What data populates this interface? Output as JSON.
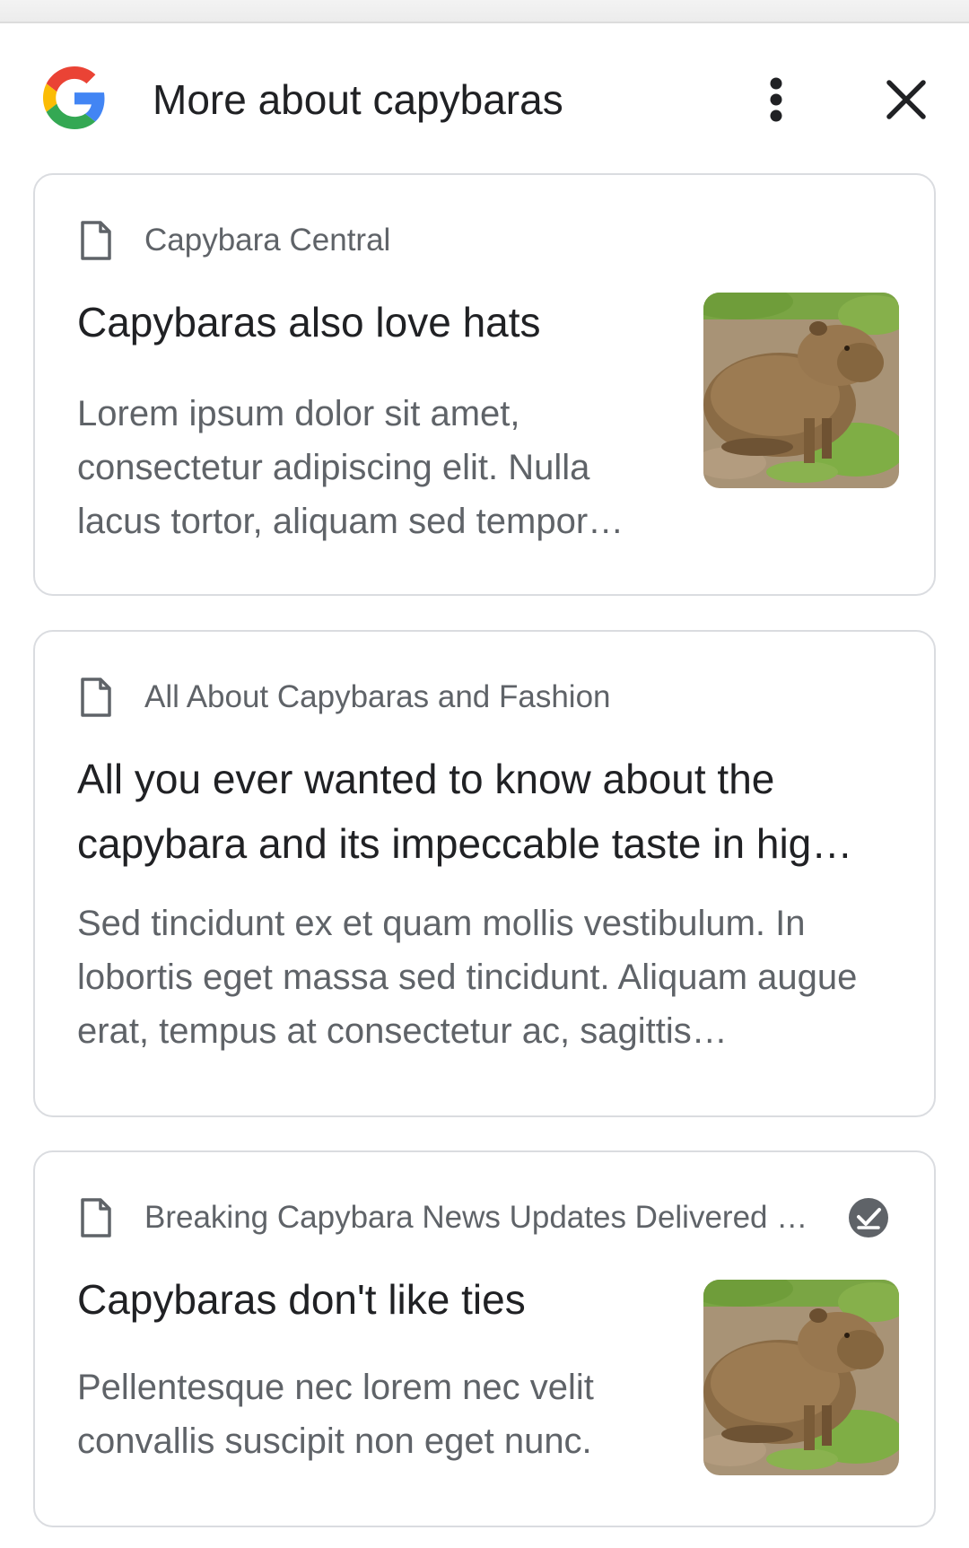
{
  "header": {
    "title": "More about capybaras",
    "logo_icon": "google-g-icon",
    "more_icon": "more-vert-icon",
    "close_icon": "close-icon"
  },
  "cards": [
    {
      "source": "Capybara Central",
      "source_icon": "document-icon",
      "title": "Capybaras also love hats",
      "snippet": "Lorem ipsum dolor sit amet, consectetur adipiscing elit. Nulla lacus tortor, aliquam sed tempor…",
      "thumbnail": "capybara-photo"
    },
    {
      "source": "All About Capybaras and Fashion",
      "source_icon": "document-icon",
      "title": "All you ever wanted to know about the capybara and its impeccable taste in hig…",
      "snippet": "Sed tincidunt ex et quam mollis vestibulum. In lobortis eget massa sed tincidunt. Aliquam augue erat, tempus at consectetur ac, sagittis…"
    },
    {
      "source": "Breaking Capybara News Updates Delivered D…",
      "source_icon": "document-icon",
      "badge_icon": "verified-check-icon",
      "title": "Capybaras don't like ties",
      "snippet": "Pellentesque nec lorem nec velit convallis suscipit non eget nunc.",
      "thumbnail": "capybara-photo"
    }
  ],
  "colors": {
    "title_text": "#202124",
    "secondary_text": "#5f6368",
    "card_border": "#dadce0",
    "google_blue": "#4285F4",
    "google_red": "#EA4335",
    "google_yellow": "#FBBC05",
    "google_green": "#34A853"
  }
}
